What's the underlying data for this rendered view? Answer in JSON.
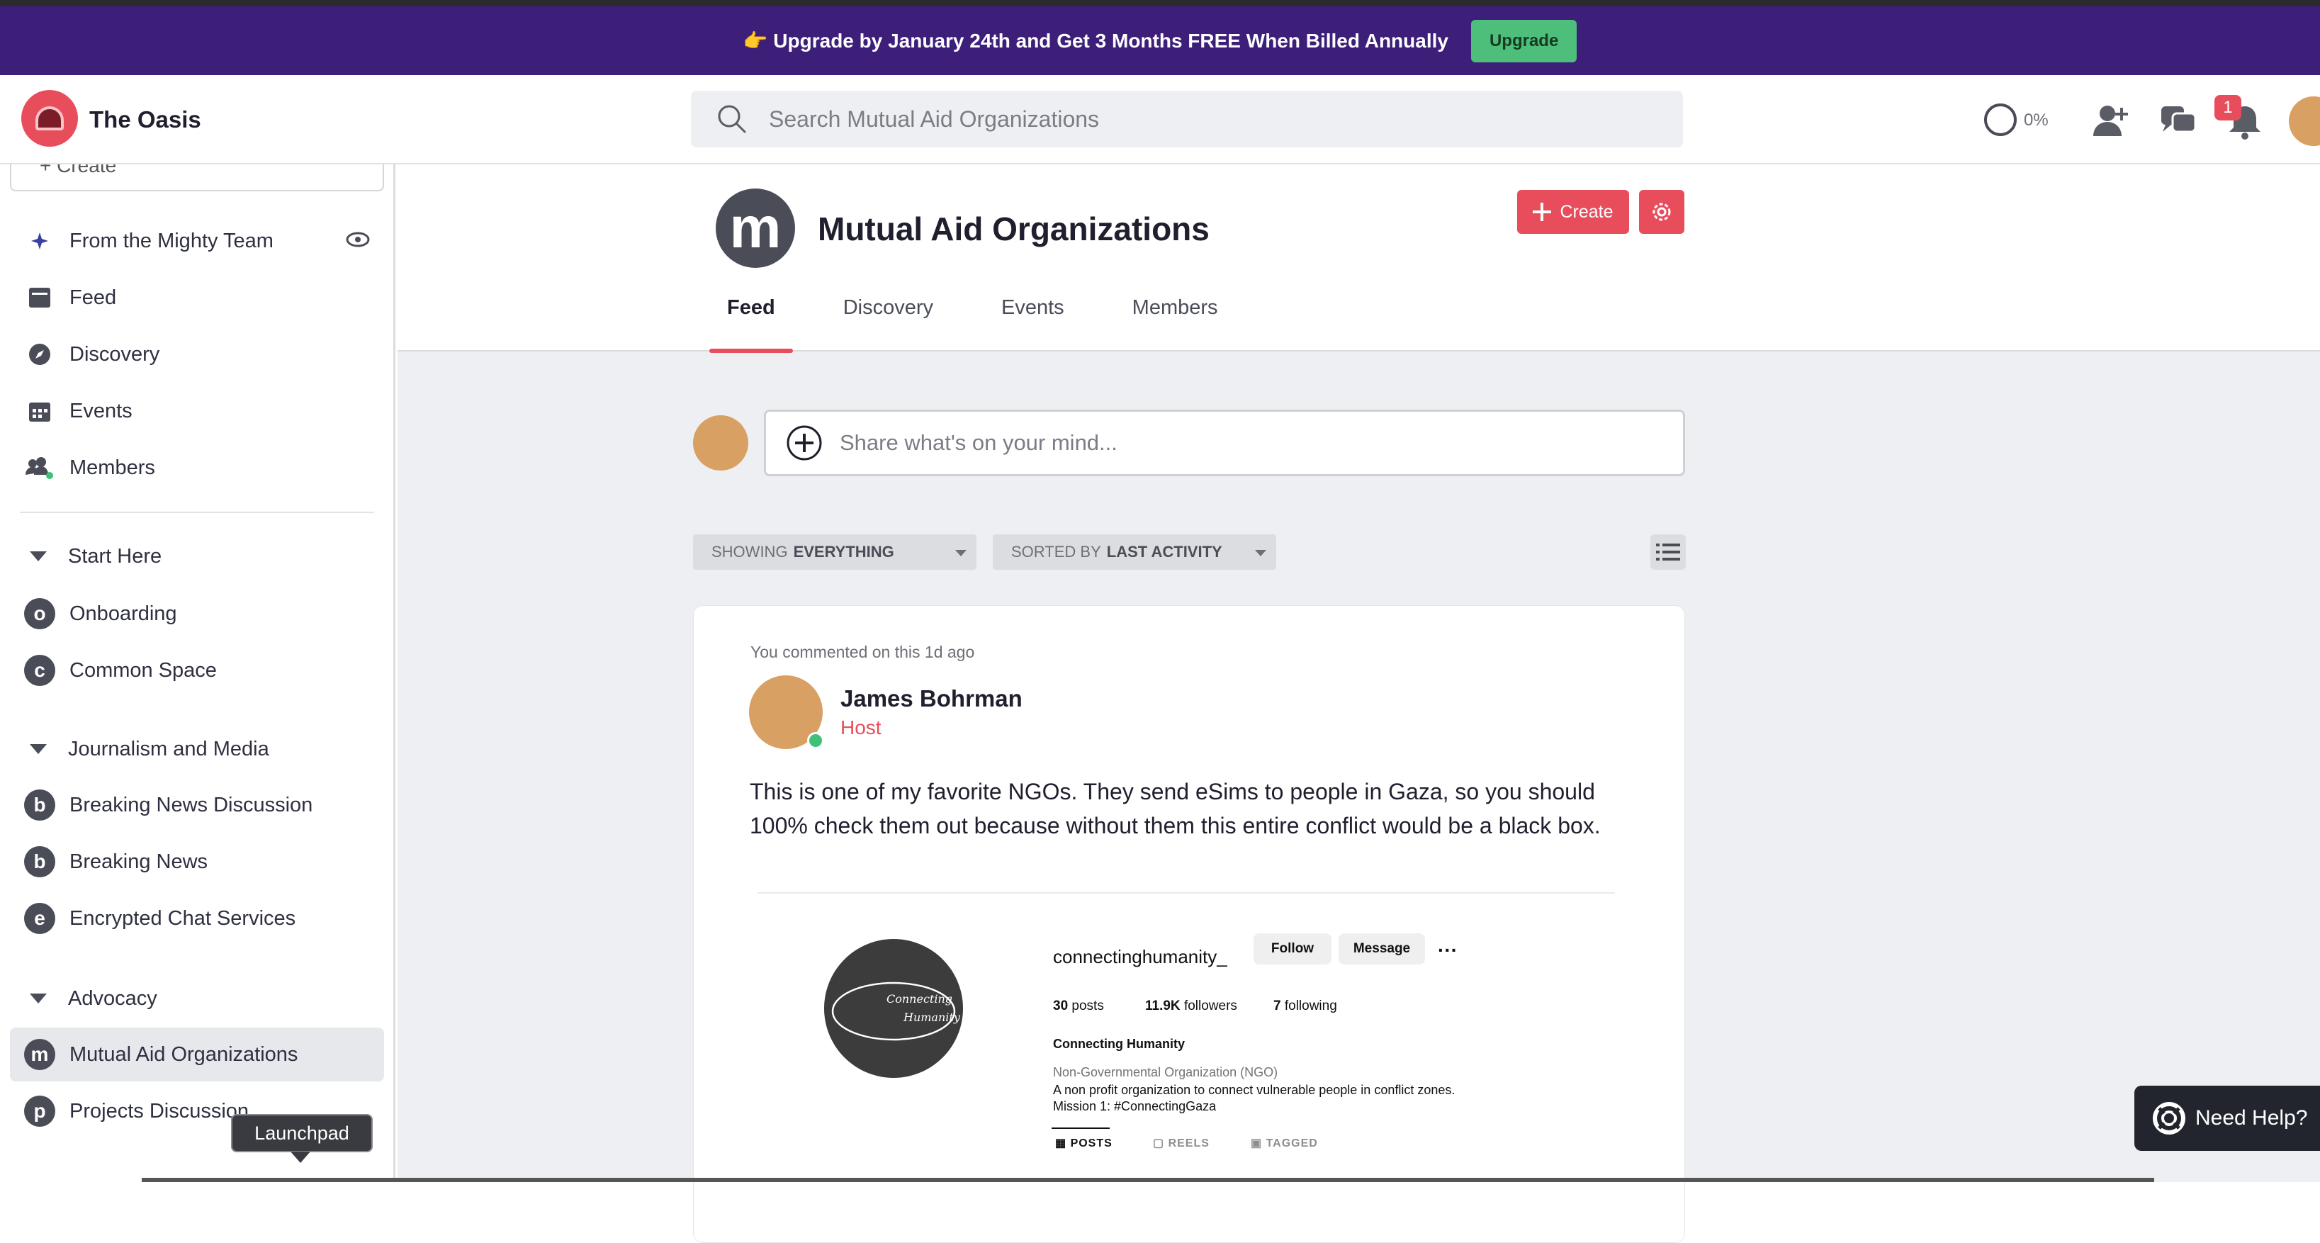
{
  "banner": {
    "text": "👉 Upgrade by January 24th and Get 3 Months FREE When Billed Annually",
    "button": "Upgrade"
  },
  "header": {
    "site_name": "The Oasis",
    "search_placeholder": "Search Mutual Aid Organizations",
    "progress": "0%",
    "notification_count": "1"
  },
  "sidebar": {
    "create_label": "+ Create",
    "items": [
      {
        "label": "From the Mighty Team",
        "icon": "sparkle-icon"
      },
      {
        "label": "Feed",
        "icon": "feed-icon"
      },
      {
        "label": "Discovery",
        "icon": "compass-icon"
      },
      {
        "label": "Events",
        "icon": "calendar-icon"
      },
      {
        "label": "Members",
        "icon": "members-icon"
      }
    ],
    "sections": [
      {
        "title": "Start Here",
        "spaces": [
          {
            "letter": "o",
            "label": "Onboarding"
          },
          {
            "letter": "c",
            "label": "Common Space"
          }
        ]
      },
      {
        "title": "Journalism and Media",
        "spaces": [
          {
            "letter": "b",
            "label": "Breaking News Discussion"
          },
          {
            "letter": "b",
            "label": "Breaking News"
          },
          {
            "letter": "e",
            "label": "Encrypted Chat Services"
          }
        ]
      },
      {
        "title": "Advocacy",
        "spaces": [
          {
            "letter": "m",
            "label": "Mutual Aid Organizations"
          },
          {
            "letter": "p",
            "label": "Projects Discussion"
          }
        ]
      }
    ],
    "tooltip": "Launchpad"
  },
  "group": {
    "letter": "m",
    "title": "Mutual Aid Organizations",
    "create_label": "Create",
    "tabs": [
      "Feed",
      "Discovery",
      "Events",
      "Members"
    ]
  },
  "composer": {
    "placeholder": "Share what's on your mind..."
  },
  "filters": {
    "showing_prefix": "SHOWING",
    "showing_value": "EVERYTHING",
    "sorted_prefix": "SORTED BY",
    "sorted_value": "LAST ACTIVITY"
  },
  "post": {
    "context": "You commented on this 1d ago",
    "author": "James Bohrman",
    "role": "Host",
    "body": "This is one of my favorite NGOs. They send eSims to people in Gaza, so you should 100% check them out because without them this entire conflict would be a black box.",
    "embed": {
      "pic_text_1": "Connecting",
      "pic_text_2": "Humanity",
      "username": "connectinghumanity_",
      "follow": "Follow",
      "message": "Message",
      "more": "···",
      "posts": "30",
      "posts_label": "posts",
      "followers": "11.9K",
      "followers_label": "followers",
      "following": "7",
      "following_label": "following",
      "name": "Connecting Humanity",
      "category": "Non-Governmental Organization (NGO)",
      "bio_1": "A non profit organization to connect vulnerable people in conflict zones.",
      "bio_2": "Mission 1: #ConnectingGaza",
      "tabs": [
        "POSTS",
        "REELS",
        "TAGGED"
      ]
    }
  },
  "help": {
    "label": "Need Help?"
  },
  "colors": {
    "accent": "#e84d5b",
    "banner": "#3d1f7a",
    "upgrade": "#4dbf7a"
  }
}
